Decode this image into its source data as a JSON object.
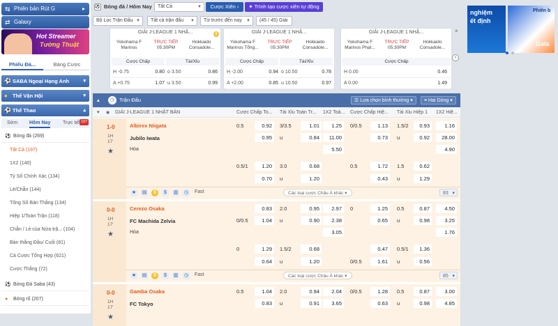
{
  "sidebar": {
    "top_buttons": [
      {
        "label": "Phiên bản Rút G",
        "icon": "compress-icon"
      },
      {
        "label": "Galaxy",
        "icon": "swap-icon"
      }
    ],
    "banner": {
      "line1": "Hot Streamer",
      "line2": "Tường Thuật"
    },
    "tabs": [
      "Phiếu Đả...",
      "Bảng Cược"
    ],
    "sections": [
      {
        "label": "SABA Ngoại Hạng Anh"
      },
      {
        "label": "Thể Vận Hội"
      },
      {
        "label": "Thể Thao"
      }
    ],
    "subtabs": [
      "Sớm",
      "Hôm Nay",
      "Trực tiếp"
    ],
    "live_badge": "197",
    "sport_main": "Bóng đá (269)",
    "bet_types": [
      "Tất Cả (197)",
      "1X2 (140)",
      "Tỷ Số Chính Xác (134)",
      "Lẻ/Chẵn (144)",
      "Tổng Số Bàn Thắng (134)",
      "Hiệp 1/Toàn Trận (118)",
      "Chẵn / Lẻ của Nửa trậ... (104)",
      "Bàn thắng Đầu/ Cuối (81)",
      "Cá Cược Tổng Hợp (621)",
      "Cược Thắng (72)"
    ],
    "other_sports": [
      "Bóng Đá Saba (43)",
      "Bóng rổ (207)"
    ]
  },
  "topbar": {
    "breadcrumb": "Bóng đá / Hôm Nay",
    "filter_all": "Tất Cả",
    "parlay": "Cược Xiên",
    "create_parlay": "Trình tạo cược xiên tự động",
    "filter_match": "Bộ Lọc Trận Đấu",
    "all_matches": "Tất cả trận đấu",
    "time_sort": "Từ trước đến nay",
    "count": "(45 / 45) Giải"
  },
  "cards": [
    {
      "league": "GIẢI J-LEAGUE 1 NHẬ...",
      "home": "Yokohama F Marinos",
      "away": "Hokkaido Consadole...",
      "live": "TRỰC TIẾP",
      "time": "05:30PM",
      "hdr_a": "Cược Chấp",
      "hdr_b": "Tài/Xỉu",
      "rows": [
        [
          "H -0.75",
          "0.80",
          "o 3.50",
          "0.86"
        ],
        [
          "A +0.75",
          "1.07",
          "u 3.50",
          "0.99"
        ]
      ]
    },
    {
      "league": "GIẢI J-LEAGUE 1 NHẬ...",
      "home": "Yokohama F Marinos Tổng...",
      "away": "Hokkaido Consadole...",
      "live": "TRỰC TIẾP",
      "time": "05:30PM",
      "hdr_a": "Cược Chấp",
      "hdr_b": "Tài/Xỉu",
      "rows": [
        [
          "H -2.00",
          "0.94",
          "o 10.50",
          "0.78"
        ],
        [
          "A +2.00",
          "0.85",
          "u 10.50",
          "0.97"
        ]
      ]
    },
    {
      "league": "GIẢI J-LEAGUE 1 NHẬ...",
      "home": "Yokohama F Marinos Phạt...",
      "away": "Hokkaido Consadole...",
      "live": "TRỰC TIẾP",
      "time": "05:30PM",
      "hdr_a": "Cược Chấp",
      "hdr_b": "",
      "rows": [
        [
          "H 0.00",
          "0.46",
          "",
          ""
        ],
        [
          "A 0.00",
          "1.49",
          "",
          ""
        ]
      ]
    }
  ],
  "right_banner": {
    "text1": "nghiệm",
    "text2": "ết định",
    "text3": "Phiên b",
    "text4": "Gala"
  },
  "main": {
    "header": "Trận Đấu",
    "sort": "Lựa chọn bình thường",
    "lines": "Hai Dòng",
    "league": "GIẢI J-LEAGUE 1 NHẬT BẢN",
    "columns": [
      "Cược Chấp To...",
      "Tài Xỉu Toàn Tr...",
      "1X2 Toà...",
      "Cược Chấp Hiệ...",
      "Tài Xỉu Hiệp 1",
      "1X2 Hiệ..."
    ],
    "more_label": "Các loại cược Châu Á khác",
    "fast": "Fast",
    "matches": [
      {
        "score": "1-0",
        "half": "1H",
        "minute": "17'",
        "home": "Albirex Niigata",
        "away": "Jubilo Iwata",
        "draw": "Hòa",
        "more_count": "83",
        "rows": [
          [
            "0.5",
            "0.92",
            "3/3.5",
            "1.01",
            "1.25",
            "0/0.5",
            "1.13",
            "1.5/2",
            "0.93",
            "1.16"
          ],
          [
            "",
            "0.95",
            "u",
            "0.84",
            "11.00",
            "",
            "0.73",
            "u",
            "0.92",
            "28.00"
          ],
          [
            "",
            "",
            "",
            "",
            "5.50",
            "",
            "",
            "",
            "",
            "4.90"
          ],
          [
            "0.5/1",
            "1.20",
            "3.0",
            "0.68",
            "",
            "0.5",
            "1.72",
            "1.5",
            "0.62",
            ""
          ],
          [
            "",
            "0.70",
            "u",
            "1.20",
            "",
            "",
            "0.43",
            "u",
            "1.29",
            ""
          ]
        ]
      },
      {
        "score": "0-0",
        "half": "1H",
        "minute": "17'",
        "home": "Cerezo Osaka",
        "away": "FC Machida Zelvia",
        "draw": "Hòa",
        "more_count": "85",
        "rows": [
          [
            "",
            "0.83",
            "2.0",
            "0.95",
            "2.97",
            "0",
            "1.25",
            "0.5",
            "0.87",
            "4.50"
          ],
          [
            "0/0.5",
            "1.04",
            "u",
            "0.90",
            "2.38",
            "",
            "0.65",
            "u",
            "0.98",
            "3.25"
          ],
          [
            "",
            "",
            "",
            "",
            "3.05",
            "",
            "",
            "",
            "",
            "1.76"
          ],
          [
            "0",
            "1.29",
            "1.5/2",
            "0.68",
            "",
            "",
            "0.47",
            "0.5/1",
            "1.36",
            ""
          ],
          [
            "",
            "0.64",
            "u",
            "1.20",
            "",
            "0/0.5",
            "1.61",
            "u",
            "0.56",
            ""
          ]
        ]
      },
      {
        "score": "0-0",
        "half": "1H",
        "minute": "17'",
        "home": "Gamba Osaka",
        "away": "FC Tokyo",
        "draw": "",
        "more_count": "",
        "rows": [
          [
            "0.5",
            "1.04",
            "2.0",
            "0.94",
            "2.04",
            "0/0.5",
            "1.28",
            "0.5",
            "0.87",
            "3.00"
          ],
          [
            "",
            "0.83",
            "u",
            "0.91",
            "3.65",
            "",
            "0.63",
            "u",
            "0.98",
            "4.85"
          ]
        ]
      }
    ]
  }
}
